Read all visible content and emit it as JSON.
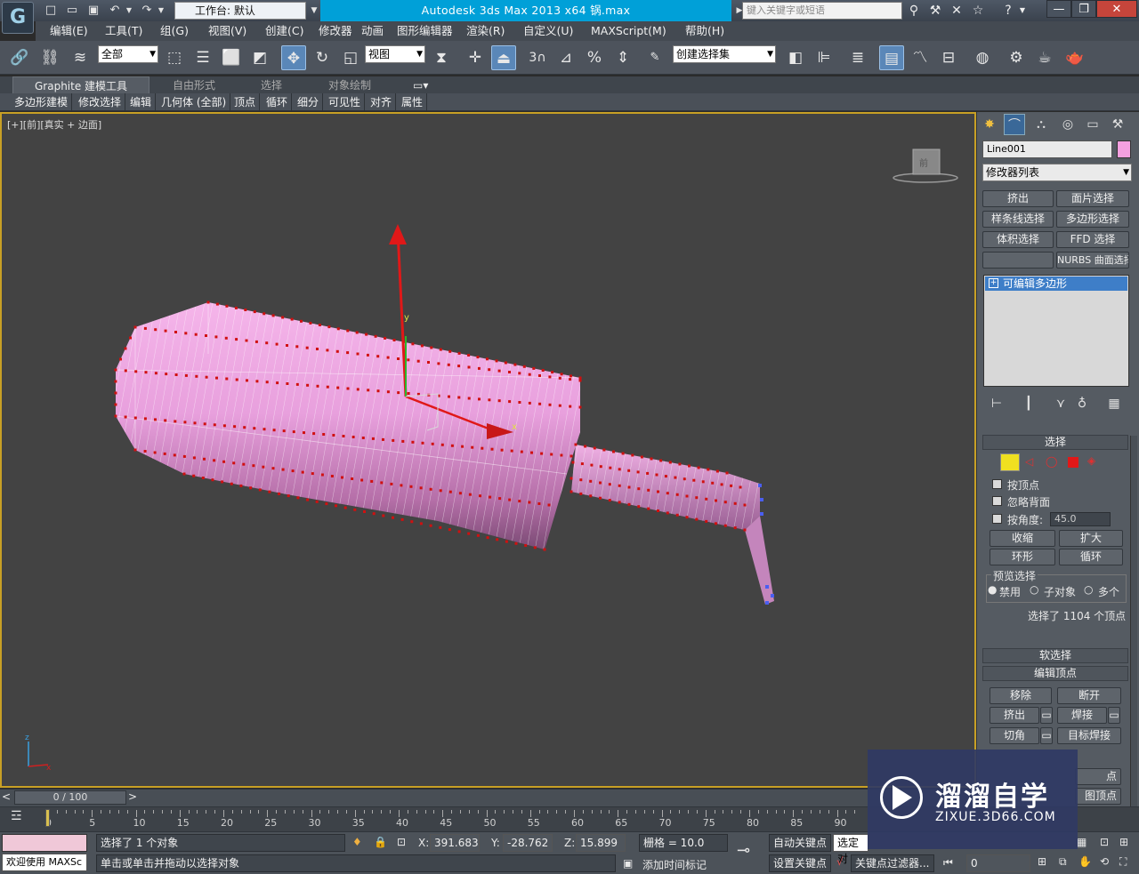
{
  "titlebar": {
    "title": "Autodesk 3ds Max  2013 x64      锅.max",
    "workspace": "工作台: 默认",
    "search_placeholder": "键入关键字或短语"
  },
  "menu": [
    "编辑(E)",
    "工具(T)",
    "组(G)",
    "视图(V)",
    "创建(C)",
    "修改器",
    "动画",
    "图形编辑器",
    "渲染(R)",
    "自定义(U)",
    "MAXScript(M)",
    "帮助(H)"
  ],
  "toolbar": {
    "selection_filter": "全部",
    "ref_coord": "视图",
    "named_selection": "创建选择集",
    "snap_label": "3"
  },
  "ribbon": {
    "tabs": [
      "Graphite 建模工具",
      "自由形式",
      "选择",
      "对象绘制"
    ],
    "panels": [
      "多边形建模",
      "修改选择",
      "编辑",
      "几何体 (全部)",
      "顶点",
      "循环",
      "细分",
      "可见性",
      "对齐",
      "属性"
    ]
  },
  "viewport": {
    "label": "[+][前][真实 + 边面]",
    "viewcube_label": "前",
    "axis_y": "y",
    "axis_x": "x",
    "corner_z": "z",
    "corner_x": "x"
  },
  "command_panel": {
    "object_name": "Line001",
    "object_color": "#f4a0e0",
    "modifier_list": "修改器列表",
    "mod_buttons": [
      "挤出",
      "面片选择",
      "样条线选择",
      "多边形选择",
      "体积选择",
      "FFD 选择",
      "",
      "NURBS 曲面选择"
    ],
    "stack_item": "可编辑多边形",
    "selection": {
      "title": "选择",
      "by_vertex": "按顶点",
      "ignore_backfacing": "忽略背面",
      "by_angle": "按角度:",
      "angle_value": "45.0",
      "shrink": "收缩",
      "grow": "扩大",
      "ring": "环形",
      "loop": "循环",
      "preview_title": "预览选择",
      "preview_off": "禁用",
      "preview_sub": "子对象",
      "preview_multi": "多个",
      "status": "选择了 1104 个顶点"
    },
    "soft_selection": "软选择",
    "edit_vertices": {
      "title": "编辑顶点",
      "remove": "移除",
      "break": "断开",
      "extrude": "挤出",
      "weld": "焊接",
      "chamfer": "切角",
      "target_weld": "目标焊接",
      "partial1": "点",
      "partial2": "图顶点"
    }
  },
  "time": {
    "frame_display": "0 / 100",
    "ticks": [
      "0",
      "5",
      "10",
      "15",
      "20",
      "25",
      "30",
      "35",
      "40",
      "45",
      "50",
      "55",
      "60",
      "65",
      "70",
      "75",
      "80",
      "85",
      "90"
    ]
  },
  "status": {
    "welcome": "欢迎使用 MAXSc",
    "selected": "选择了 1 个对象",
    "prompt": "单击或单击并拖动以选择对象",
    "x_label": "X:",
    "x": "391.683",
    "y_label": "Y:",
    "y": "-28.762",
    "z_label": "Z:",
    "z": "15.899",
    "grid": "栅格 = 10.0",
    "add_time_tag": "添加时间标记",
    "auto_key": "自动关键点",
    "selected_dd": "选定对",
    "set_key": "设置关键点",
    "key_filters": "关键点过滤器...",
    "frame": "0"
  },
  "watermark": {
    "brand": "溜溜自学",
    "url": "ZIXUE.3D66.COM"
  }
}
